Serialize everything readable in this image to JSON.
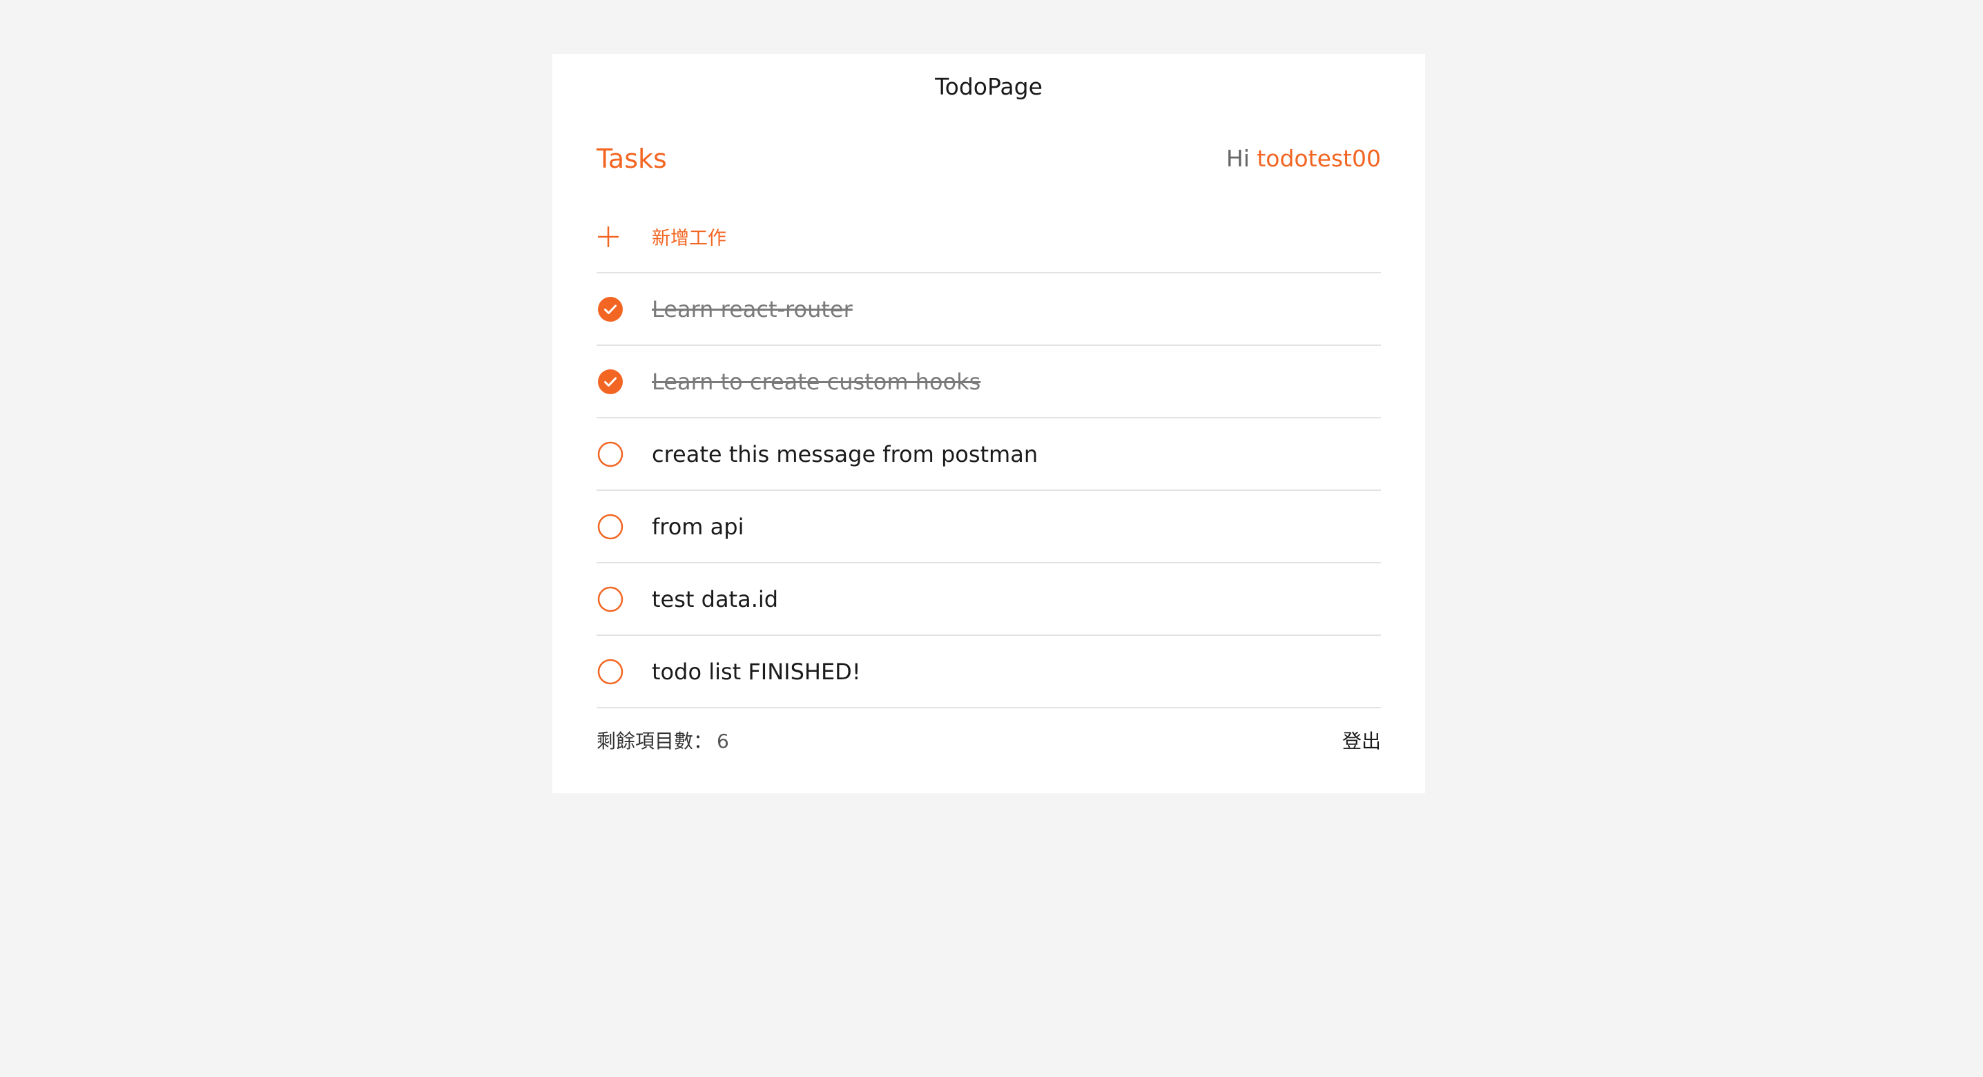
{
  "app": {
    "title": "TodoPage"
  },
  "header": {
    "tasks_label": "Tasks",
    "greeting_prefix": "Hi",
    "user_name": "todotest00"
  },
  "add_task": {
    "label": "新增工作",
    "icon": "plus-icon"
  },
  "todos": [
    {
      "text": "Learn react-router",
      "completed": true
    },
    {
      "text": "Learn to create custom hooks",
      "completed": true
    },
    {
      "text": "create this message from postman",
      "completed": false
    },
    {
      "text": "from api",
      "completed": false
    },
    {
      "text": "test data.id",
      "completed": false
    },
    {
      "text": "todo list FINISHED!",
      "completed": false
    }
  ],
  "footer": {
    "remaining_label": "剩餘項目數：",
    "remaining_count": "6",
    "logout_label": "登出"
  },
  "colors": {
    "accent": "#f26522",
    "background": "#f4f4f4",
    "card": "#ffffff",
    "divider": "#e3e3e3"
  }
}
